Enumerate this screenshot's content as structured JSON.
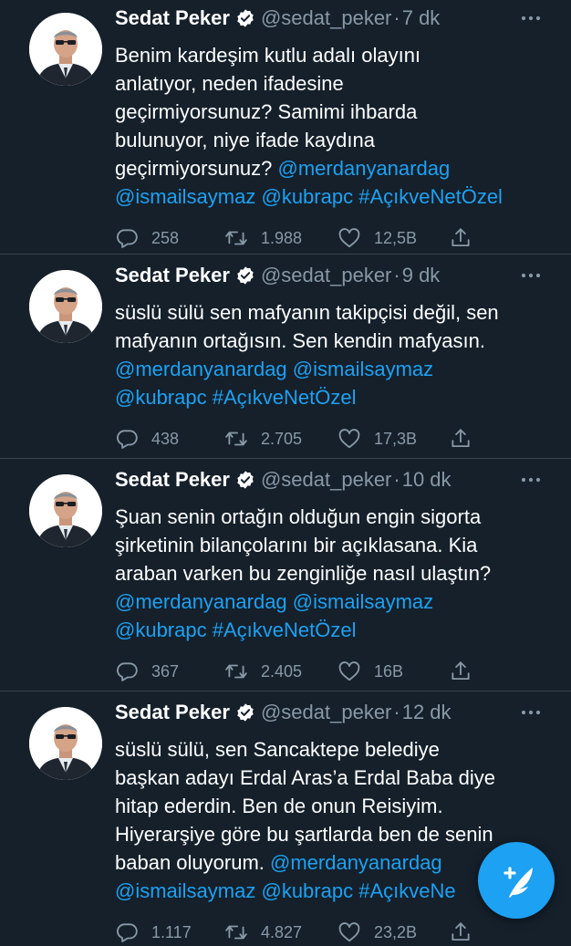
{
  "colors": {
    "background": "#15202b",
    "text": "#ffffff",
    "muted": "#8899a6",
    "link": "#1da1f2",
    "divider": "#38444d"
  },
  "compose_button": {
    "icon": "compose-feather-icon"
  },
  "tweets": [
    {
      "author": {
        "name": "Sedat Peker",
        "handle": "@sedat_peker",
        "verified": true
      },
      "time": "7 dk",
      "lines": [
        [
          "Benim kardeşim kutlu adalı olayını"
        ],
        [
          "anlatıyor, neden ifadesine"
        ],
        [
          "geçirmiyorsunuz? Samimi ihbarda"
        ],
        [
          "bulunuyor, niye ifade kaydına"
        ],
        [
          "geçirmiyorsunuz? ",
          "@merdanyanardag"
        ],
        [
          "@ismailsaymaz",
          " ",
          "@kubrapc",
          " ",
          "#AçıkveNetÖzel"
        ]
      ],
      "stats": {
        "replies": "258",
        "retweets": "1.988",
        "likes": "12,5B"
      }
    },
    {
      "author": {
        "name": "Sedat Peker",
        "handle": "@sedat_peker",
        "verified": true
      },
      "time": "9 dk",
      "lines": [
        [
          "süslü sülü sen mafyanın takipçisi değil, sen"
        ],
        [
          "mafyanın ortağısın. Sen kendin mafyasın."
        ],
        [
          "@merdanyanardag",
          " ",
          "@ismailsaymaz"
        ],
        [
          "@kubrapc",
          " ",
          "#AçıkveNetÖzel"
        ]
      ],
      "stats": {
        "replies": "438",
        "retweets": "2.705",
        "likes": "17,3B"
      }
    },
    {
      "author": {
        "name": "Sedat Peker",
        "handle": "@sedat_peker",
        "verified": true
      },
      "time": "10 dk",
      "lines": [
        [
          "Şuan senin ortağın olduğun engin sigorta"
        ],
        [
          "şirketinin bilançolarını bir açıklasana. Kia"
        ],
        [
          "araban varken bu zenginliğe nasıl ulaştın?"
        ],
        [
          "@merdanyanardag",
          " ",
          "@ismailsaymaz"
        ],
        [
          "@kubrapc",
          " ",
          "#AçıkveNetÖzel"
        ]
      ],
      "stats": {
        "replies": "367",
        "retweets": "2.405",
        "likes": "16B"
      }
    },
    {
      "author": {
        "name": "Sedat Peker",
        "handle": "@sedat_peker",
        "verified": true
      },
      "time": "12 dk",
      "lines": [
        [
          "süslü sülü, sen Sancaktepe belediye"
        ],
        [
          "başkan adayı Erdal Aras’a Erdal Baba diye"
        ],
        [
          "hitap ederdin. Ben de onun Reisiyim."
        ],
        [
          "Hiyerarşiye göre bu şartlarda ben de senin"
        ],
        [
          "baban oluyorum. ",
          "@merdanyanardag"
        ],
        [
          "@ismailsaymaz",
          " ",
          "@kubrapc",
          " ",
          "#AçıkveNe"
        ]
      ],
      "stats": {
        "replies": "1.117",
        "retweets": "4.827",
        "likes": "23,2B"
      }
    }
  ]
}
